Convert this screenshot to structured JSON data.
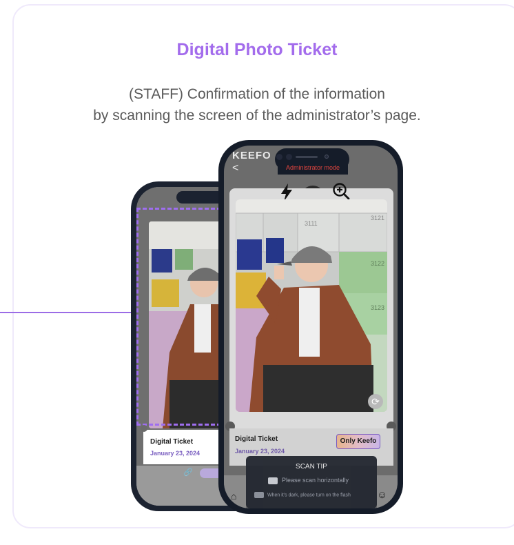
{
  "header": {
    "title": "Digital Photo Ticket",
    "subtitle_line1": "(STAFF) Confirmation of the information",
    "subtitle_line2": "by scanning the screen of the administrator’s page."
  },
  "back_phone": {
    "ticket_label": "Digital Ticket",
    "date": "January 23, 2024",
    "link_icon": "link-icon"
  },
  "front_phone": {
    "app_logo": "KEEFO",
    "back_glyph": "<",
    "mode_label": "Administrator mode",
    "ticket_label": "Digital Ticket",
    "date": "January 23, 2024",
    "badge": "Only Keefo",
    "scan_tip": {
      "title": "SCAN TIP",
      "tip1": "Please scan horizontally",
      "tip2": "When it’s dark, please turn on the flash"
    },
    "icons": [
      "flash-icon",
      "zoom-in-icon",
      "refresh-icon",
      "home-icon",
      "smile-icon"
    ]
  },
  "colors": {
    "accent": "#a36cec",
    "frame_dashed": "#9f6ef0",
    "admin_label": "#e2453f",
    "phone_body": "#151c29"
  }
}
